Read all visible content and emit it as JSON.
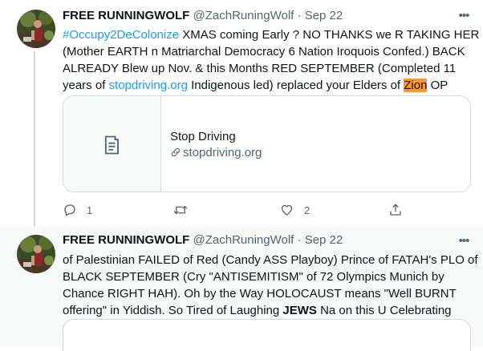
{
  "tweets": [
    {
      "author": {
        "name": "FREE RUNNINGWOLF",
        "handle": "@ZachRuningWolf",
        "date": "Sep 22"
      },
      "text": {
        "hashtag": "#Occupy2DeColonize",
        "part1": " XMAS coming Early ? NO THANKS we R TAKING HER (Mother EARTH n Matriarchal Democracy 6 Nation Iroquois Confed.) BACK ALREADY Blew up Nov. & this Months RED SEPTEMBER (Completed 11 years of ",
        "link": "stopdriving.org",
        "part2": " Indigenous led) replaced your Elders of ",
        "highlighted": "Zion",
        "part3": " OP"
      },
      "card": {
        "title": "Stop Driving",
        "url": "stopdriving.org",
        "thumb_icon": "document-icon"
      },
      "actions": {
        "reply_count": "1",
        "retweet_count": "",
        "like_count": "2"
      }
    },
    {
      "author": {
        "name": "FREE RUNNINGWOLF",
        "handle": "@ZachRuningWolf",
        "date": "Sep 22"
      },
      "text": {
        "part1": "of Palestinian FAILED of Red (Candy ASS Playboy) Prince of FATAH's PLO of BLACK SEPTEMBER (Cry \"ANTISEMITISM\" of 72 Olympics Munich by Chance RIGHT HAH). Oh by the Way HOLOCAUST means \"Well BURNT offering\" in Yiddish. So Tired of Laughing ",
        "bold": "JEWS",
        "part2": " Na on this U Celebrating during Sera"
      }
    }
  ],
  "ui": {
    "separator": "·",
    "more_glyph": "•••"
  },
  "colors": {
    "link": "#1d9bf0",
    "muted": "#536471",
    "highlight": "#ff9632",
    "border": "#cfd9de"
  }
}
